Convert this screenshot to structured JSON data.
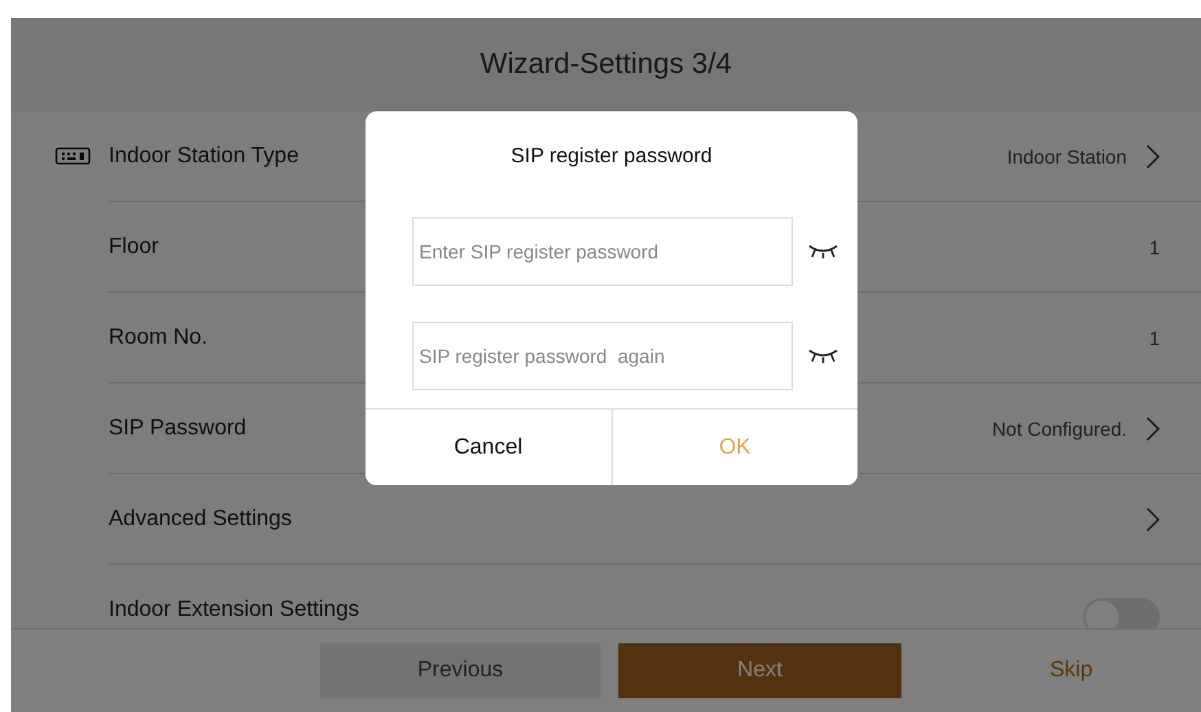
{
  "header": {
    "title": "Wizard-Settings 3/4"
  },
  "rows": [
    {
      "kind": "link",
      "icon": true,
      "label": "Indoor Station Type",
      "value": "Indoor Station"
    },
    {
      "kind": "value",
      "label": "Floor",
      "value": "1"
    },
    {
      "kind": "value",
      "label": "Room No.",
      "value": "1"
    },
    {
      "kind": "link",
      "label": "SIP Password",
      "value": "Not Configured."
    },
    {
      "kind": "link",
      "label": "Advanced Settings"
    },
    {
      "kind": "toggle",
      "label": "Indoor Extension Settings",
      "on": false
    }
  ],
  "footer": {
    "buttons": [
      {
        "kind": "secondary",
        "label": "Previous"
      },
      {
        "kind": "primary",
        "label": "Next"
      },
      {
        "kind": "text",
        "label": "Skip"
      }
    ]
  },
  "dialog": {
    "title": "SIP register password",
    "fields": [
      {
        "placeholder": "Enter SIP register password"
      },
      {
        "placeholder": "SIP register password  again"
      }
    ],
    "buttons": [
      {
        "kind": "cancel",
        "label": "Cancel"
      },
      {
        "kind": "confirm",
        "label": "OK"
      }
    ]
  }
}
